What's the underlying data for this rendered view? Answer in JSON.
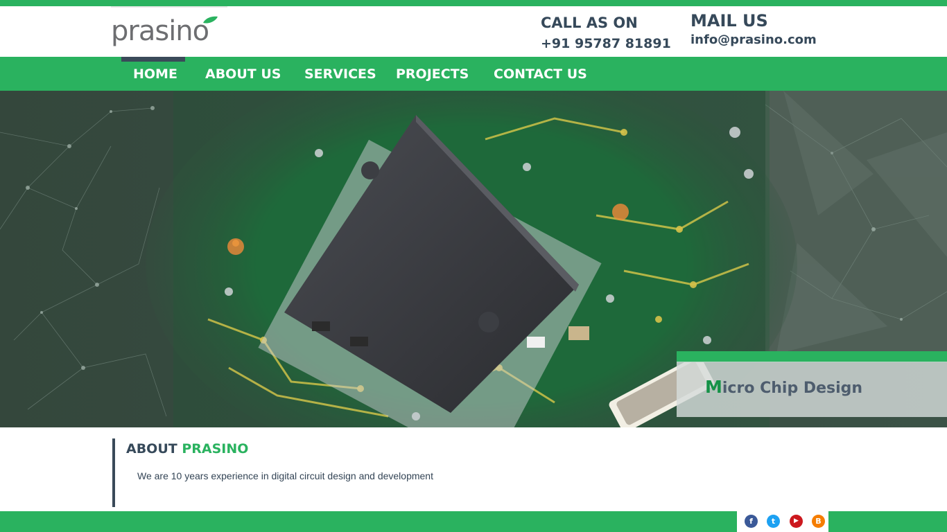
{
  "brand": {
    "logo_text": "prasino",
    "colors": {
      "green": "#2ab25f",
      "dark": "#36495a",
      "leaf": "#2ab25f"
    }
  },
  "header": {
    "call": {
      "title": "CALL AS ON",
      "value": "+91 95787 81891"
    },
    "mail": {
      "title": "MAIL US",
      "value": "info@prasino.com"
    }
  },
  "nav": {
    "items": [
      {
        "label": "HOME",
        "active": true
      },
      {
        "label": "ABOUT US"
      },
      {
        "label": "SERVICES"
      },
      {
        "label": "PROJECTS"
      },
      {
        "label": "CONTACT US"
      }
    ]
  },
  "hero": {
    "caption_first_letter": "M",
    "caption_rest": "icro Chip Design",
    "image": "circuit-board-microchip"
  },
  "about": {
    "title_prefix": "ABOUT",
    "title_accent": "PRASINO",
    "text": "We are 10 years experience in digital circuit design and development"
  },
  "social": {
    "icons": [
      {
        "name": "facebook-icon",
        "glyph": "f",
        "color": "#3b5998"
      },
      {
        "name": "twitter-icon",
        "glyph": "t",
        "color": "#1da1f2"
      },
      {
        "name": "youtube-icon",
        "glyph": "▶",
        "color": "#cc181e"
      },
      {
        "name": "blogger-icon",
        "glyph": "B",
        "color": "#f57d00"
      }
    ]
  }
}
